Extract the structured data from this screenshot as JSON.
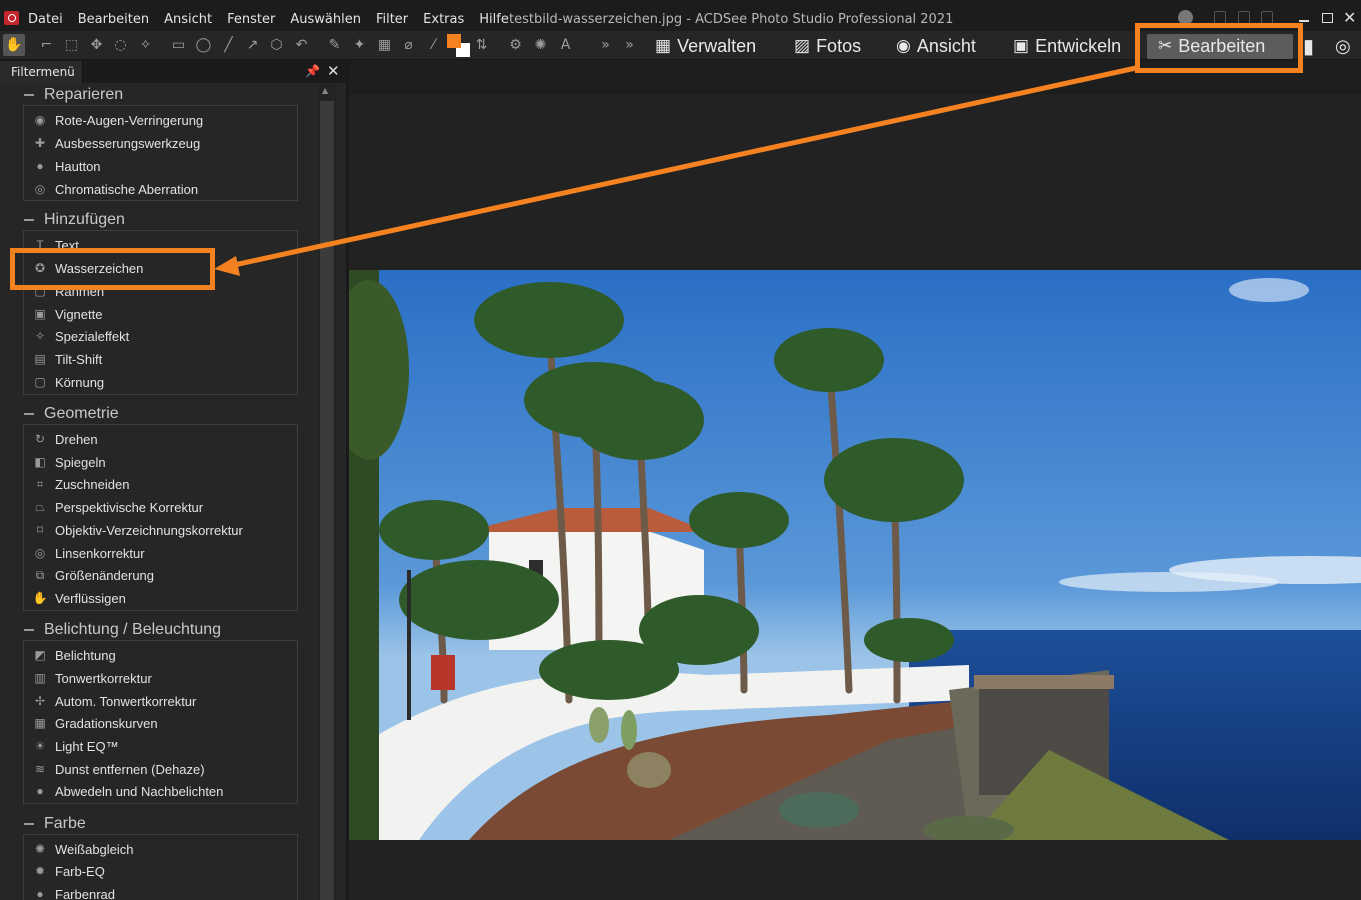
{
  "app": {
    "window_title": "testbild-wasserzeichen.jpg - ACDSee Photo Studio Professional 2021",
    "menu": [
      "Datei",
      "Bearbeiten",
      "Ansicht",
      "Fenster",
      "Auswählen",
      "Filter",
      "Extras",
      "Hilfe"
    ]
  },
  "modes": {
    "verwalten": "Verwalten",
    "fotos": "Fotos",
    "ansicht": "Ansicht",
    "entwickeln": "Entwickeln",
    "bearbeiten": "Bearbeiten"
  },
  "toolbar": {
    "colors": {
      "foreground": "#f58220",
      "background": "#ffffff"
    }
  },
  "panel": {
    "title": "Filtermenü",
    "groups": [
      {
        "title": "Reparieren",
        "items": [
          "Rote-Augen-Verringerung",
          "Ausbesserungswerkzeug",
          "Hautton",
          "Chromatische Aberration"
        ]
      },
      {
        "title": "Hinzufügen",
        "items": [
          "Text",
          "Wasserzeichen",
          "Rahmen",
          "Vignette",
          "Spezialeffekt",
          "Tilt-Shift",
          "Körnung"
        ]
      },
      {
        "title": "Geometrie",
        "items": [
          "Drehen",
          "Spiegeln",
          "Zuschneiden",
          "Perspektivische Korrektur",
          "Objektiv-Verzeichnungskorrektur",
          "Linsenkorrektur",
          "Größenänderung",
          "Verflüssigen"
        ]
      },
      {
        "title": "Belichtung / Beleuchtung",
        "items": [
          "Belichtung",
          "Tonwertkorrektur",
          "Autom. Tonwertkorrektur",
          "Gradationskurven",
          "Light EQ™",
          "Dunst entfernen (Dehaze)",
          "Abwedeln und Nachbelichten"
        ]
      },
      {
        "title": "Farbe",
        "items": [
          "Weißabgleich",
          "Farb-EQ",
          "Farbenrad"
        ]
      }
    ]
  },
  "annotation": {
    "highlight_color": "#f58220"
  }
}
